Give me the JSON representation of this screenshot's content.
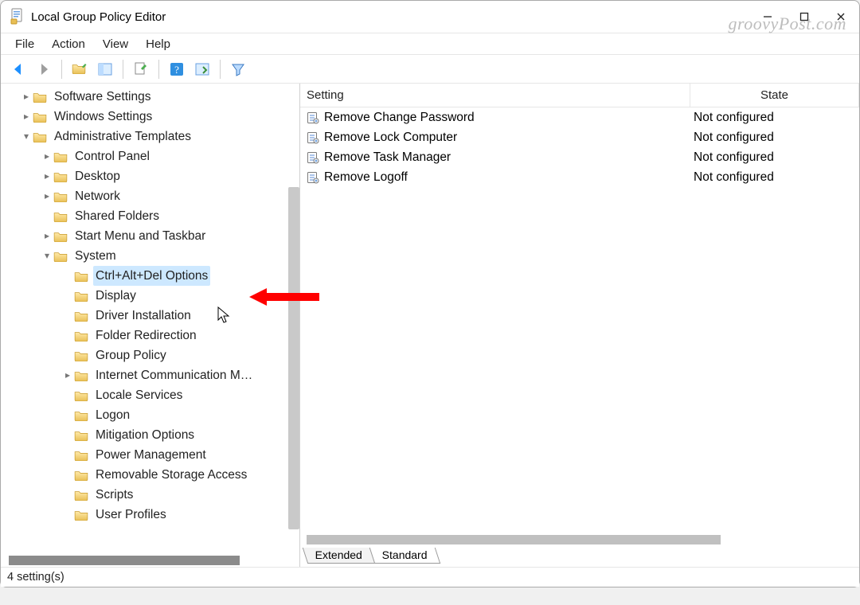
{
  "window": {
    "title": "Local Group Policy Editor"
  },
  "watermark": "groovyPost.com",
  "menu": {
    "file": "File",
    "action": "Action",
    "view": "View",
    "help": "Help"
  },
  "tree": {
    "n0": "Software Settings",
    "n1": "Windows Settings",
    "n2": "Administrative Templates",
    "n3": "Control Panel",
    "n4": "Desktop",
    "n5": "Network",
    "n6": "Shared Folders",
    "n7": "Start Menu and Taskbar",
    "n8": "System",
    "n9": "Ctrl+Alt+Del Options",
    "n10": "Display",
    "n11": "Driver Installation",
    "n12": "Folder Redirection",
    "n13": "Group Policy",
    "n14": "Internet Communication M…",
    "n15": "Locale Services",
    "n16": "Logon",
    "n17": "Mitigation Options",
    "n18": "Power Management",
    "n19": "Removable Storage Access",
    "n20": "Scripts",
    "n21": "User Profiles"
  },
  "columns": {
    "setting": "Setting",
    "state": "State"
  },
  "rows": [
    {
      "setting": "Remove Change Password",
      "state": "Not configured"
    },
    {
      "setting": "Remove Lock Computer",
      "state": "Not configured"
    },
    {
      "setting": "Remove Task Manager",
      "state": "Not configured"
    },
    {
      "setting": "Remove Logoff",
      "state": "Not configured"
    }
  ],
  "tabs": {
    "extended": "Extended",
    "standard": "Standard"
  },
  "status": "4 setting(s)"
}
